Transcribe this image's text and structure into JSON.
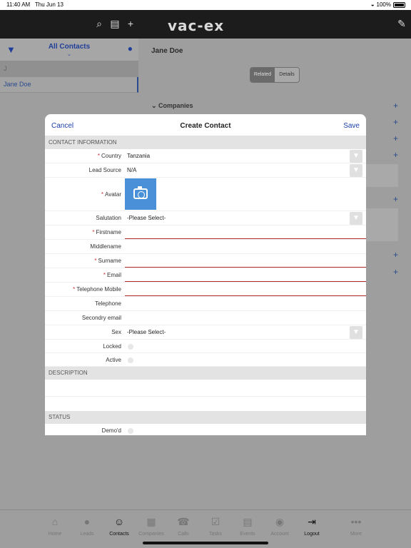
{
  "status": {
    "time": "11:40 AM",
    "date": "Thu Jun 13",
    "battery": "100%"
  },
  "topnav": {
    "logo": "vac-ex"
  },
  "left": {
    "list_title": "All Contacts",
    "section_letter": "J",
    "items": [
      {
        "label": "Jane Doe"
      }
    ]
  },
  "right": {
    "title": "Jane Doe",
    "seg_related": "Related",
    "seg_details": "Details",
    "companies_label": "Companies"
  },
  "modal": {
    "cancel": "Cancel",
    "title": "Create Contact",
    "save": "Save",
    "sections": {
      "contact": "CONTACT INFORMATION",
      "description": "DESCRIPTION",
      "status": "STATUS"
    },
    "fields": {
      "country": {
        "label": "Country",
        "value": "Tanzania"
      },
      "lead_source": {
        "label": "Lead Source",
        "value": "N/A"
      },
      "avatar": {
        "label": "Avatar"
      },
      "salutation": {
        "label": "Salutation",
        "value": "-Please Select-"
      },
      "firstname": {
        "label": "Firstname",
        "value": ""
      },
      "middlename": {
        "label": "Middlename",
        "value": ""
      },
      "surname": {
        "label": "Surname",
        "value": ""
      },
      "email": {
        "label": "Email",
        "value": ""
      },
      "telephone_mobile": {
        "label": "Telephone Mobile",
        "value": ""
      },
      "telephone": {
        "label": "Telephone",
        "value": ""
      },
      "secondary_email": {
        "label": "Secondry email",
        "value": ""
      },
      "sex": {
        "label": "Sex",
        "value": "-Please Select-"
      },
      "locked": {
        "label": "Locked"
      },
      "active": {
        "label": "Active"
      },
      "demod": {
        "label": "Demo'd"
      }
    }
  },
  "tabs": [
    {
      "label": "Home",
      "icon": "home-icon"
    },
    {
      "label": "Leads",
      "icon": "chat-icon"
    },
    {
      "label": "Contacts",
      "icon": "person-icon"
    },
    {
      "label": "Companies",
      "icon": "building-icon"
    },
    {
      "label": "Calls",
      "icon": "phone-icon"
    },
    {
      "label": "Tasks",
      "icon": "check-icon"
    },
    {
      "label": "Events",
      "icon": "calendar-icon"
    },
    {
      "label": "Account",
      "icon": "account-icon"
    },
    {
      "label": "Logout",
      "icon": "logout-icon"
    },
    {
      "label": "More",
      "icon": "more-icon"
    }
  ],
  "colors": {
    "accent": "#1a3fa8",
    "error": "#b52a2a",
    "avatar_button": "#4a90d9",
    "nav": "#1c1c1c"
  }
}
